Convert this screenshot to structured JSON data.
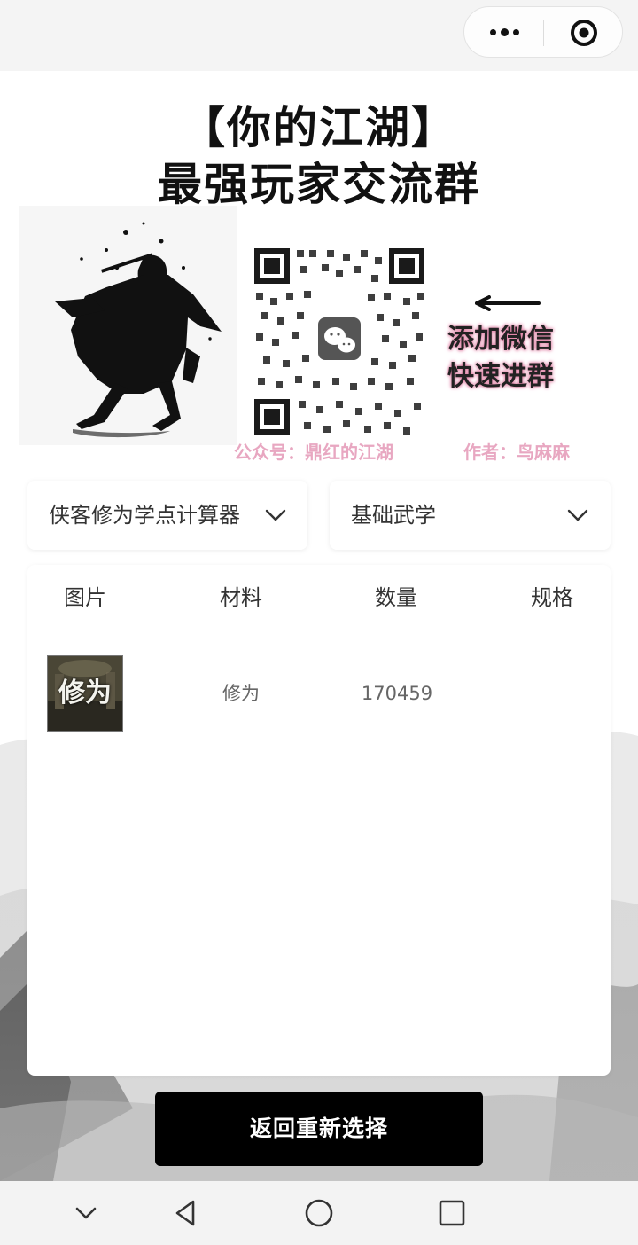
{
  "capsule": {
    "more_icon": "more-dots-icon",
    "target_icon": "target-icon"
  },
  "banner": {
    "title_line1": "【你的江湖】",
    "title_line2": "最强玩家交流群",
    "side_line1": "添加微信",
    "side_line2": "快速进群",
    "credit_account": "公众号：鼎红的江湖",
    "credit_author": "作者：鸟麻麻",
    "accent_color": "#e07fa4"
  },
  "filters": {
    "calculator_select": "侠客修为学点计算器",
    "category_select": "基础武学"
  },
  "table": {
    "headers": [
      "图片",
      "材料",
      "数量",
      "规格"
    ],
    "rows": [
      {
        "image_text": "修为",
        "material": "修为",
        "quantity": "170459",
        "spec": ""
      }
    ]
  },
  "actions": {
    "reset_label": "返回重新选择"
  },
  "system_nav": {
    "icons": [
      "chevron-down-icon",
      "back-triangle-icon",
      "home-circle-icon",
      "recents-square-icon"
    ]
  }
}
